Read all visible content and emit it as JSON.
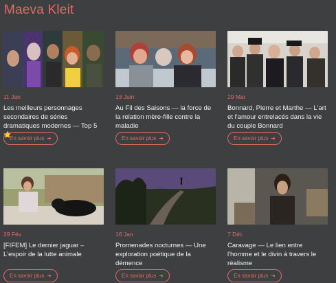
{
  "header": {
    "title": "Maeva Kleit"
  },
  "button_label": "En savoir plus",
  "accent_color": "#e46a6a",
  "cards": [
    {
      "date": "11 Jan",
      "title": "Les meilleurs personnages secondaires de séries dramatiques modernes — Top 5",
      "emoji": "⭐",
      "image": "series-characters-collage"
    },
    {
      "date": "13 Juin",
      "title": "Au Fil des Saisons — la force de la relation mère-fille contre la maladie",
      "image": "three-women-in-bed"
    },
    {
      "date": "29 Mai",
      "title": "Bonnard, Pierre et Marthe — L'art et l'amour entrelacés dans la vie du couple Bonnard",
      "image": "period-crowd-of-men"
    },
    {
      "date": "29 Fév",
      "title": "[FIFEM] Le dernier jaguar – L'espoir de la lutte animale",
      "image": "girl-with-black-jaguar"
    },
    {
      "date": "16 Jan",
      "title": "Promenades nocturnes — Une exploration poétique de la démence",
      "image": "figure-on-hill-at-dusk"
    },
    {
      "date": "7 Déc",
      "title": "Caravage — Le lien entre l'homme et le divin à travers le réalisme",
      "image": "painter-in-studio"
    }
  ]
}
